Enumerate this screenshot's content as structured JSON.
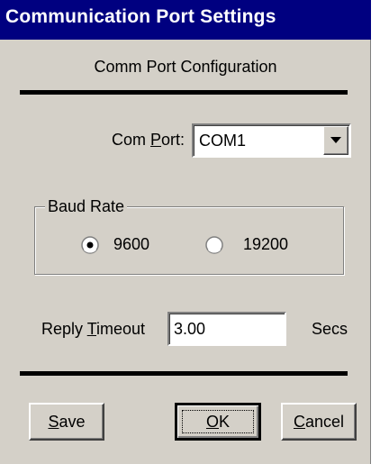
{
  "window": {
    "title": "Communication Port Settings",
    "title_bar_color": "#000080",
    "background_color": "#d4d0c8"
  },
  "section": {
    "title": "Comm Port Configuration"
  },
  "com_port": {
    "label_pre": "Com ",
    "label_accel": "P",
    "label_post": "ort:",
    "value": "COM1",
    "dropdown_icon": "chevron-down-icon"
  },
  "baud_rate": {
    "group_label": "Baud Rate",
    "options": [
      {
        "label": "9600",
        "selected": true
      },
      {
        "label": "19200",
        "selected": false
      }
    ]
  },
  "reply_timeout": {
    "label_pre": "Reply ",
    "label_accel": "T",
    "label_post": "imeout",
    "value": "3.00",
    "unit": "Secs"
  },
  "buttons": {
    "save": {
      "accel": "S",
      "rest": "ave"
    },
    "ok": {
      "accel": "O",
      "rest": "K"
    },
    "cancel": {
      "accel": "C",
      "rest": "ancel"
    }
  }
}
